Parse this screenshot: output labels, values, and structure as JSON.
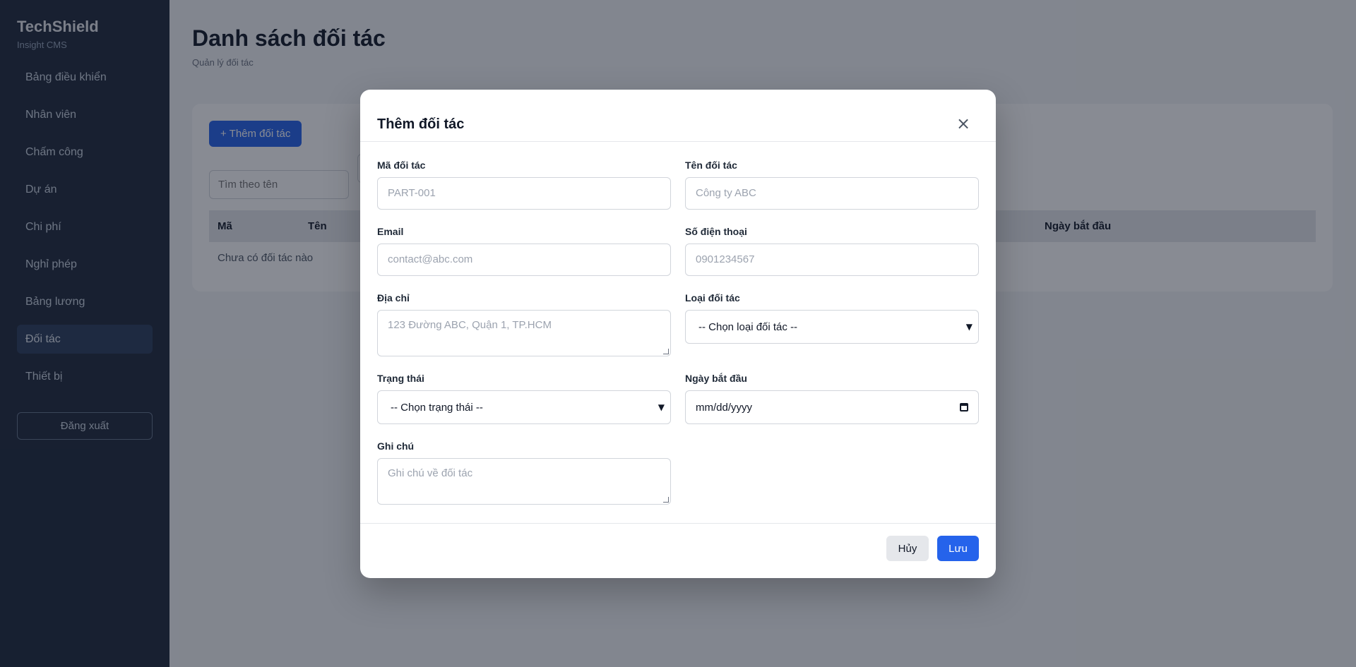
{
  "sidebar": {
    "brand_title": "TechShield",
    "brand_subtitle": "Insight CMS",
    "items": [
      {
        "label": "Bảng điều khiển"
      },
      {
        "label": "Nhân viên"
      },
      {
        "label": "Chấm công"
      },
      {
        "label": "Dự án"
      },
      {
        "label": "Chi phí"
      },
      {
        "label": "Nghỉ phép"
      },
      {
        "label": "Bảng lương"
      },
      {
        "label": "Đối tác"
      },
      {
        "label": "Thiết bị"
      }
    ],
    "active_item": "Đối tác",
    "logout_label": "Đăng xuất"
  },
  "main": {
    "title": "Danh sách đối tác",
    "subtitle": "Quản lý đối tác",
    "add_button": "+ Thêm đối tác",
    "search_placeholder": "Tìm theo tên",
    "table": {
      "columns": {
        "code": "Mã",
        "name": "Tên",
        "start_date": "Ngày bắt đầu"
      },
      "empty_text": "Chưa có đối tác nào"
    }
  },
  "modal": {
    "title": "Thêm đối tác",
    "close_icon": "×",
    "fields": {
      "code": {
        "label": "Mã đối tác",
        "placeholder": "PART-001"
      },
      "name": {
        "label": "Tên đối tác",
        "placeholder": "Công ty ABC"
      },
      "email": {
        "label": "Email",
        "placeholder": "contact@abc.com"
      },
      "phone": {
        "label": "Số điện thoại",
        "placeholder": "0901234567"
      },
      "address": {
        "label": "Địa chỉ",
        "placeholder": "123 Đường ABC, Quận 1, TP.HCM"
      },
      "type": {
        "label": "Loại đối tác",
        "value": "-- Chọn loại đối tác --"
      },
      "status": {
        "label": "Trạng thái",
        "value": "-- Chọn trạng thái --"
      },
      "start_date": {
        "label": "Ngày bắt đầu",
        "value": "mm/dd/yyyy"
      },
      "note": {
        "label": "Ghi chú",
        "placeholder": "Ghi chú về đối tác"
      }
    },
    "cancel_label": "Hủy",
    "save_label": "Lưu"
  },
  "colors": {
    "sidebar_bg": "#1e293b",
    "accent": "#2563eb",
    "overlay": "rgba(17,24,39,0.5)"
  }
}
